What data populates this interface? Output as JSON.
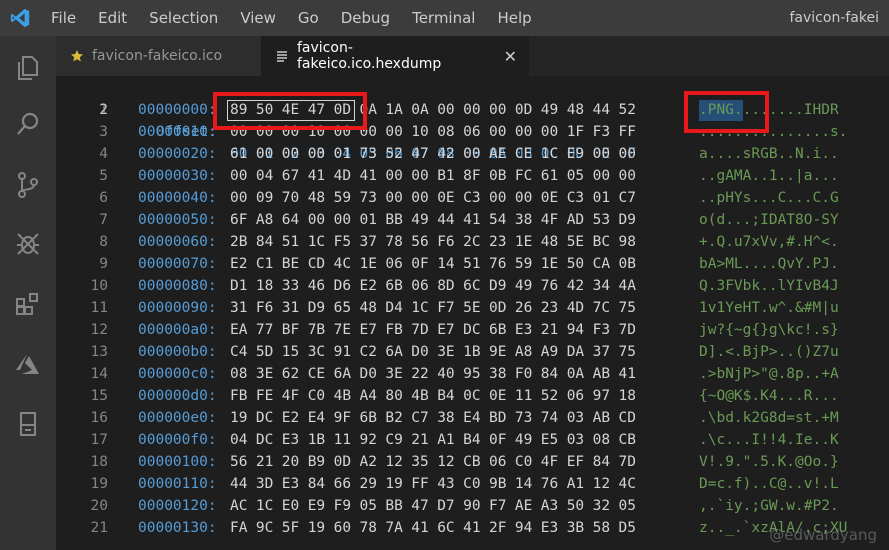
{
  "menu": [
    "File",
    "Edit",
    "Selection",
    "View",
    "Go",
    "Debug",
    "Terminal",
    "Help"
  ],
  "window_title": "favicon-fakei",
  "tabs": [
    {
      "label": "favicon-fakeico.ico",
      "active": false
    },
    {
      "label": "favicon-fakeico.ico.hexdump",
      "active": true
    }
  ],
  "header": {
    "label": "Offset:",
    "columns": [
      "00",
      "01",
      "02",
      "03",
      "04",
      "05",
      "06",
      "07",
      "08",
      "09",
      "0A",
      "0B",
      "0C",
      "0D",
      "0E",
      "0F"
    ]
  },
  "rows": [
    {
      "offset": "00000000:",
      "hex": [
        "89",
        "50",
        "4E",
        "47",
        "0D",
        "0A",
        "1A",
        "0A",
        "00",
        "00",
        "00",
        "0D",
        "49",
        "48",
        "44",
        "52"
      ],
      "ascii": ".PNG........IHDR"
    },
    {
      "offset": "00000010:",
      "hex": [
        "00",
        "00",
        "00",
        "10",
        "00",
        "00",
        "00",
        "10",
        "08",
        "06",
        "00",
        "00",
        "00",
        "1F",
        "F3",
        "FF"
      ],
      "ascii": "...............s."
    },
    {
      "offset": "00000020:",
      "hex": [
        "61",
        "00",
        "00",
        "00",
        "01",
        "73",
        "52",
        "47",
        "42",
        "00",
        "AE",
        "CE",
        "1C",
        "E9",
        "00",
        "00"
      ],
      "ascii": "a....sRGB..N.i.."
    },
    {
      "offset": "00000030:",
      "hex": [
        "00",
        "04",
        "67",
        "41",
        "4D",
        "41",
        "00",
        "00",
        "B1",
        "8F",
        "0B",
        "FC",
        "61",
        "05",
        "00",
        "00"
      ],
      "ascii": "..gAMA..1..|a..."
    },
    {
      "offset": "00000040:",
      "hex": [
        "00",
        "09",
        "70",
        "48",
        "59",
        "73",
        "00",
        "00",
        "0E",
        "C3",
        "00",
        "00",
        "0E",
        "C3",
        "01",
        "C7"
      ],
      "ascii": "..pHYs...C...C.G"
    },
    {
      "offset": "00000050:",
      "hex": [
        "6F",
        "A8",
        "64",
        "00",
        "00",
        "01",
        "BB",
        "49",
        "44",
        "41",
        "54",
        "38",
        "4F",
        "AD",
        "53",
        "D9"
      ],
      "ascii": "o(d...;IDAT8O-SY"
    },
    {
      "offset": "00000060:",
      "hex": [
        "2B",
        "84",
        "51",
        "1C",
        "F5",
        "37",
        "78",
        "56",
        "F6",
        "2C",
        "23",
        "1E",
        "48",
        "5E",
        "BC",
        "98"
      ],
      "ascii": "+.Q.u7xVv,#.H^<."
    },
    {
      "offset": "00000070:",
      "hex": [
        "E2",
        "C1",
        "BE",
        "CD",
        "4C",
        "1E",
        "06",
        "0F",
        "14",
        "51",
        "76",
        "59",
        "1E",
        "50",
        "CA",
        "0B"
      ],
      "ascii": "bA>ML....QvY.PJ."
    },
    {
      "offset": "00000080:",
      "hex": [
        "D1",
        "18",
        "33",
        "46",
        "D6",
        "E2",
        "6B",
        "06",
        "8D",
        "6C",
        "D9",
        "49",
        "76",
        "42",
        "34",
        "4A"
      ],
      "ascii": "Q.3FVbk..lYIvB4J"
    },
    {
      "offset": "00000090:",
      "hex": [
        "31",
        "F6",
        "31",
        "D9",
        "65",
        "48",
        "D4",
        "1C",
        "F7",
        "5E",
        "0D",
        "26",
        "23",
        "4D",
        "7C",
        "75"
      ],
      "ascii": "1v1YeHT.w^.&#M|u"
    },
    {
      "offset": "000000a0:",
      "hex": [
        "EA",
        "77",
        "BF",
        "7B",
        "7E",
        "E7",
        "FB",
        "7D",
        "E7",
        "DC",
        "6B",
        "E3",
        "21",
        "94",
        "F3",
        "7D"
      ],
      "ascii": "jw?{~g{}g\\kc!.s}"
    },
    {
      "offset": "000000b0:",
      "hex": [
        "C4",
        "5D",
        "15",
        "3C",
        "91",
        "C2",
        "6A",
        "D0",
        "3E",
        "1B",
        "9E",
        "A8",
        "A9",
        "DA",
        "37",
        "75"
      ],
      "ascii": "D].<.BjP>..()Z7u"
    },
    {
      "offset": "000000c0:",
      "hex": [
        "08",
        "3E",
        "62",
        "CE",
        "6A",
        "D0",
        "3E",
        "22",
        "40",
        "95",
        "38",
        "F0",
        "84",
        "0A",
        "AB",
        "41"
      ],
      "ascii": ".>bNjP>\"@.8p..+A"
    },
    {
      "offset": "000000d0:",
      "hex": [
        "FB",
        "FE",
        "4F",
        "C0",
        "4B",
        "A4",
        "80",
        "4B",
        "B4",
        "0C",
        "0E",
        "11",
        "52",
        "06",
        "97",
        "18"
      ],
      "ascii": "{~O@K$.K4...R..."
    },
    {
      "offset": "000000e0:",
      "hex": [
        "19",
        "DC",
        "E2",
        "E4",
        "9F",
        "6B",
        "B2",
        "C7",
        "38",
        "E4",
        "BD",
        "73",
        "74",
        "03",
        "AB",
        "CD"
      ],
      "ascii": ".\\bd.k2G8d=st.+M"
    },
    {
      "offset": "000000f0:",
      "hex": [
        "04",
        "DC",
        "E3",
        "1B",
        "11",
        "92",
        "C9",
        "21",
        "A1",
        "B4",
        "0F",
        "49",
        "E5",
        "03",
        "08",
        "CB"
      ],
      "ascii": ".\\c...I!!4.Ie..K"
    },
    {
      "offset": "00000100:",
      "hex": [
        "56",
        "21",
        "20",
        "B9",
        "0D",
        "A2",
        "12",
        "35",
        "12",
        "CB",
        "06",
        "C0",
        "4F",
        "EF",
        "84",
        "7D"
      ],
      "ascii": "V!.9.\".5.K.@Oo.}"
    },
    {
      "offset": "00000110:",
      "hex": [
        "44",
        "3D",
        "E3",
        "84",
        "66",
        "29",
        "19",
        "FF",
        "43",
        "C0",
        "9B",
        "14",
        "76",
        "A1",
        "12",
        "4C"
      ],
      "ascii": "D=c.f)..C@..v!.L"
    },
    {
      "offset": "00000120:",
      "hex": [
        "AC",
        "1C",
        "E0",
        "E9",
        "F9",
        "05",
        "BB",
        "47",
        "D7",
        "90",
        "F7",
        "AE",
        "A3",
        "50",
        "32",
        "05"
      ],
      "ascii": ",.`iy.;GW.w.#P2."
    },
    {
      "offset": "00000130:",
      "hex": [
        "FA",
        "9C",
        "5F",
        "19",
        "60",
        "78",
        "7A",
        "41",
        "6C",
        "41",
        "2F",
        "94",
        "E3",
        "3B",
        "58",
        "D5"
      ],
      "ascii": "z.._.`xzAlA/.c;XU"
    }
  ],
  "watermark": "@edwardyang",
  "colors": {
    "offset": "#569cd6",
    "ascii": "#6a9955",
    "hex": "#d4d4d4",
    "annotation": "#e8191b"
  }
}
